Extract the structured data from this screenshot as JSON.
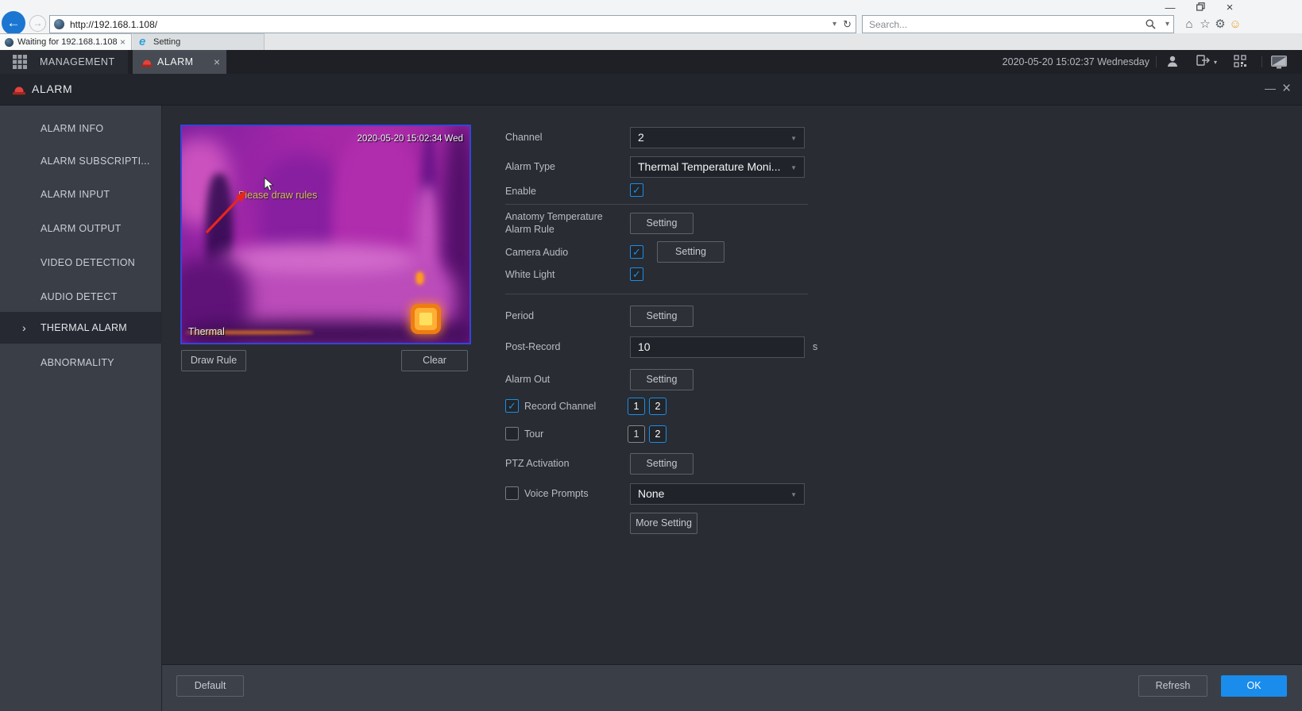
{
  "browser": {
    "url": "http://192.168.1.108/",
    "search_placeholder": "Search...",
    "active_tab": "Waiting for 192.168.1.108",
    "second_tab": "Setting"
  },
  "app_header": {
    "management": "MANAGEMENT",
    "alarm_tab": "ALARM",
    "datetime": "2020-05-20 15:02:37 Wednesday"
  },
  "panel": {
    "title": "ALARM"
  },
  "sidebar": {
    "items": [
      {
        "label": "ALARM INFO"
      },
      {
        "label": "ALARM SUBSCRIPTI..."
      },
      {
        "label": "ALARM INPUT"
      },
      {
        "label": "ALARM OUTPUT"
      },
      {
        "label": "VIDEO DETECTION"
      },
      {
        "label": "AUDIO DETECT"
      },
      {
        "label": "THERMAL ALARM"
      },
      {
        "label": "ABNORMALITY"
      }
    ],
    "selected": "THERMAL ALARM"
  },
  "video": {
    "timestamp": "2020-05-20 15:02:34 Wed",
    "hint": "Please draw rules",
    "stream_label": "Thermal",
    "draw_rule": "Draw Rule",
    "clear": "Clear"
  },
  "form": {
    "channel_label": "Channel",
    "channel_value": "2",
    "alarm_type_label": "Alarm Type",
    "alarm_type_value": "Thermal Temperature Moni...",
    "enable_label": "Enable",
    "anatomy_label": "Anatomy Temperature Alarm Rule",
    "camera_audio_label": "Camera Audio",
    "white_light_label": "White Light",
    "period_label": "Period",
    "post_record_label": "Post-Record",
    "post_record_value": "10",
    "post_record_unit": "s",
    "alarm_out_label": "Alarm Out",
    "record_channel_label": "Record Channel",
    "tour_label": "Tour",
    "ptz_label": "PTZ Activation",
    "voice_prompts_label": "Voice Prompts",
    "voice_prompts_value": "None",
    "setting": "Setting",
    "more_setting": "More Setting",
    "channels": [
      "1",
      "2"
    ],
    "record_channel_selected": [
      "1",
      "2"
    ],
    "tour_selected": [
      "2"
    ],
    "enable_checked": true,
    "camera_audio_checked": true,
    "white_light_checked": true,
    "record_channel_checked": true,
    "tour_checked": false,
    "voice_prompts_checked": false
  },
  "footer": {
    "default": "Default",
    "refresh": "Refresh",
    "ok": "OK"
  },
  "icons": {
    "back": "←",
    "forward": "→",
    "caret_down": "▾",
    "refresh": "↻",
    "home": "⌂",
    "star": "☆",
    "gear": "⚙",
    "smiley": "☺",
    "minimize": "—",
    "close": "×",
    "check": "✓",
    "chevron_right": "›",
    "select_caret": "▼"
  },
  "colors": {
    "accent_blue": "#1a8ceb",
    "checkbox_blue": "#1c8de8",
    "video_border": "#3544da",
    "hint_yellow": "#cfc157",
    "arrow_red": "#e8251d",
    "smiley_yellow": "#e8a33d"
  }
}
